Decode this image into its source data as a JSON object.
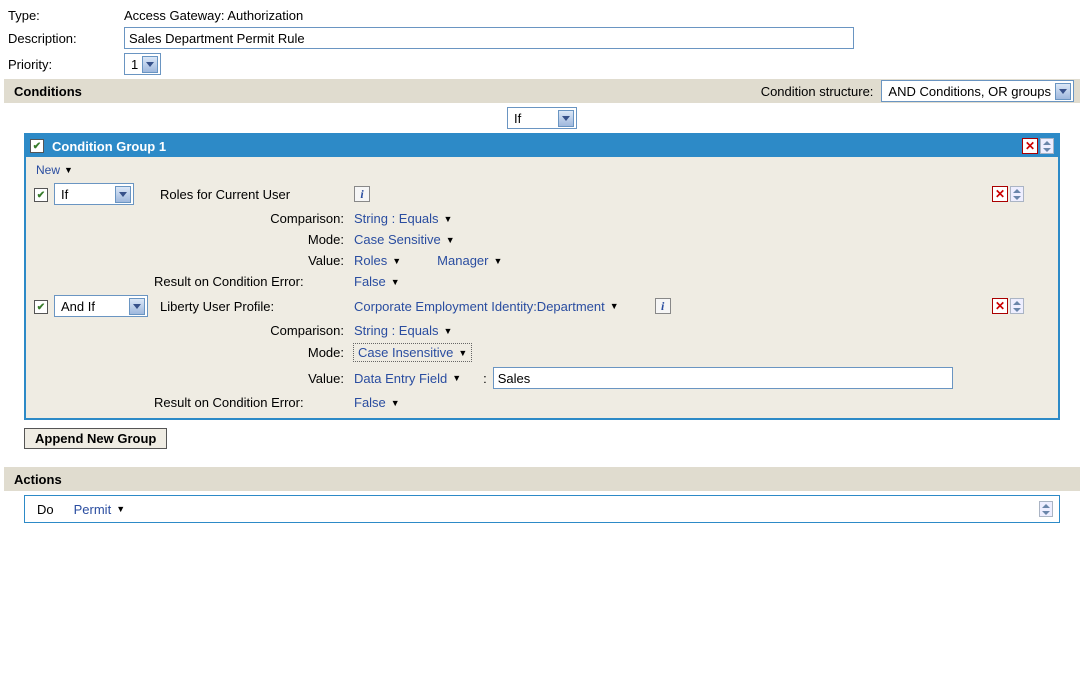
{
  "header": {
    "type_label": "Type:",
    "type_value": "Access Gateway: Authorization",
    "description_label": "Description:",
    "description_value": "Sales Department Permit Rule",
    "priority_label": "Priority:",
    "priority_value": "1"
  },
  "conditions": {
    "section_title": "Conditions",
    "structure_label": "Condition structure:",
    "structure_value": "AND Conditions, OR groups",
    "top_operator": "If",
    "group": {
      "title": "Condition Group 1",
      "new_label": "New",
      "items": [
        {
          "operator": "If",
          "attr_label": "Roles for Current User",
          "comparison_label": "Comparison:",
          "comparison_value": "String : Equals",
          "mode_label": "Mode:",
          "mode_value": "Case Sensitive",
          "value_label": "Value:",
          "value_type": "Roles",
          "value_val": "Manager",
          "error_label": "Result on Condition Error:",
          "error_value": "False"
        },
        {
          "operator": "And If",
          "attr_label": "Liberty User Profile:",
          "attr_value": "Corporate Employment Identity:Department",
          "comparison_label": "Comparison:",
          "comparison_value": "String : Equals",
          "mode_label": "Mode:",
          "mode_value": "Case Insensitive",
          "value_label": "Value:",
          "value_type": "Data Entry Field",
          "value_sep": ":",
          "value_input": "Sales",
          "error_label": "Result on Condition Error:",
          "error_value": "False"
        }
      ]
    },
    "append_label": "Append New Group"
  },
  "actions": {
    "section_title": "Actions",
    "do_label": "Do",
    "do_value": "Permit"
  }
}
